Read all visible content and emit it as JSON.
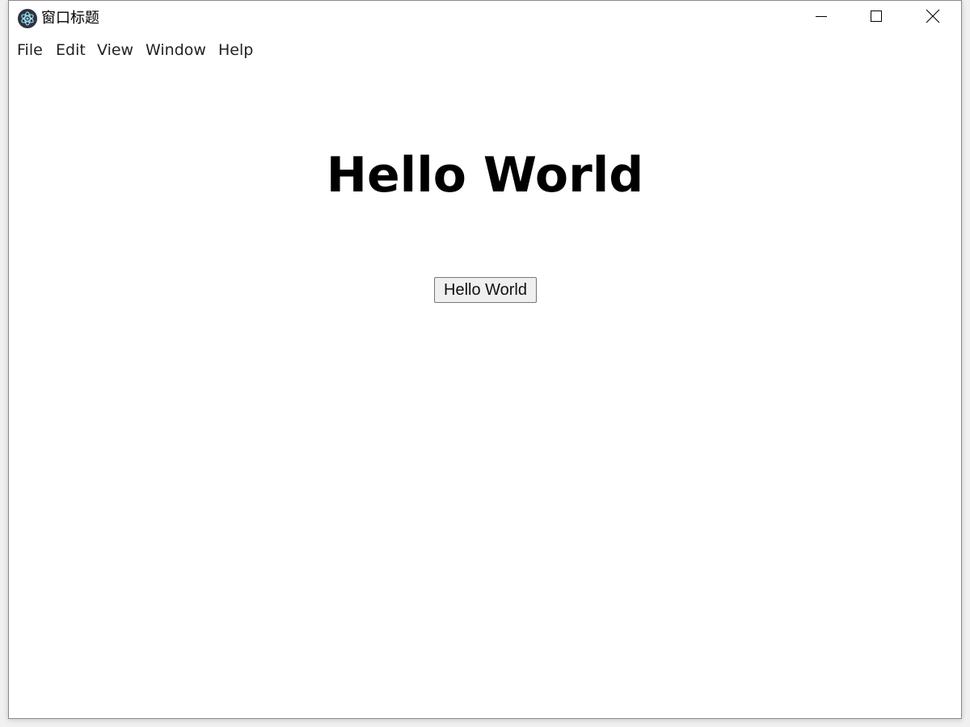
{
  "window": {
    "title": "窗口标题"
  },
  "icons": {
    "app": "electron-atom-icon",
    "minimize": "minimize-icon",
    "maximize": "maximize-icon",
    "close": "close-icon"
  },
  "menubar": {
    "items": [
      {
        "label": "File"
      },
      {
        "label": "Edit"
      },
      {
        "label": "View"
      },
      {
        "label": "Window"
      },
      {
        "label": "Help"
      }
    ]
  },
  "main": {
    "heading": "Hello World",
    "button_label": "Hello World"
  },
  "colors": {
    "window_background": "#ffffff",
    "app_icon": "#2f3241",
    "app_icon_accent": "#9feaf9"
  }
}
